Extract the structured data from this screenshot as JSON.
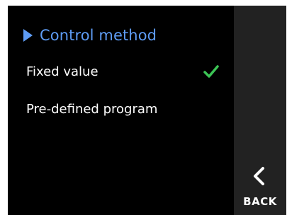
{
  "header": {
    "title": "Control method",
    "indicator_icon": "triangle-right-icon",
    "color": "#5e9cf5"
  },
  "options": [
    {
      "label": "Fixed value",
      "selected": true,
      "status_icon": "checkmark-icon"
    },
    {
      "label": "Pre-defined program",
      "selected": false
    }
  ],
  "check_color": "#3cc455",
  "nav": {
    "back_label": "BACK",
    "back_icon": "chevron-left-icon"
  },
  "colors": {
    "screen_background": "#000000",
    "side_panel": "#222222",
    "text": "#ffffff"
  }
}
